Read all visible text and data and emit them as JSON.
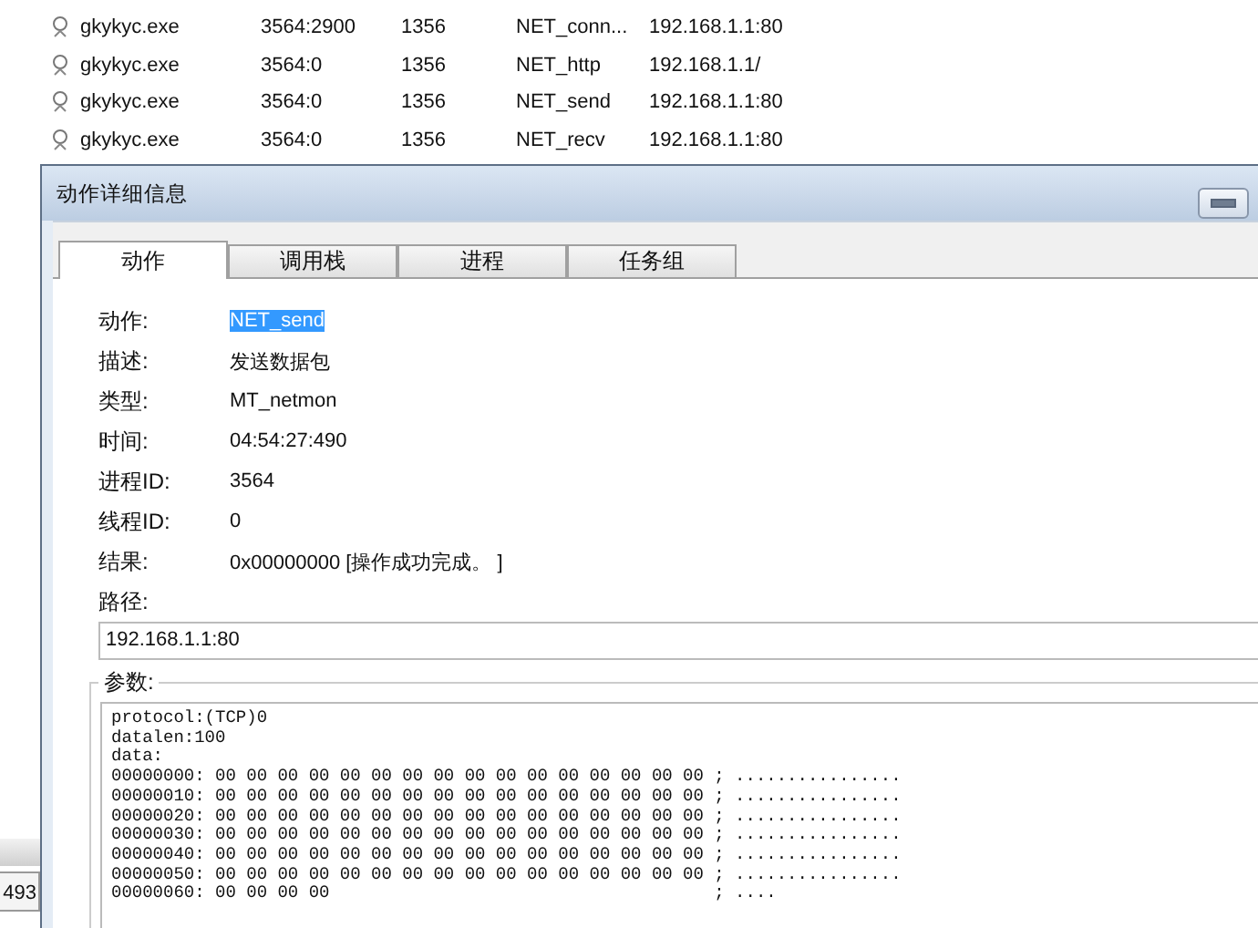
{
  "process_list": {
    "rows": [
      {
        "name": "gkykyc.exe",
        "pid_tid": "3564:2900",
        "column_4": "1356",
        "action": "NET_conn...",
        "path": "192.168.1.1:80"
      },
      {
        "name": "gkykyc.exe",
        "pid_tid": "3564:0",
        "column_4": "1356",
        "action": "NET_http",
        "path": "192.168.1.1/"
      },
      {
        "name": "gkykyc.exe",
        "pid_tid": "3564:0",
        "column_4": "1356",
        "action": "NET_send",
        "path": "192.168.1.1:80"
      },
      {
        "name": "gkykyc.exe",
        "pid_tid": "3564:0",
        "column_4": "1356",
        "action": "NET_recv",
        "path": "192.168.1.1:80"
      }
    ],
    "status_cell": "493"
  },
  "dialog": {
    "title": "动作详细信息",
    "tabs": [
      {
        "label": "动作",
        "selected": true
      },
      {
        "label": "调用栈",
        "selected": false
      },
      {
        "label": "进程",
        "selected": false
      },
      {
        "label": "任务组",
        "selected": false
      }
    ],
    "fields": [
      {
        "label": "动作:",
        "value": "NET_send",
        "highlighted": true
      },
      {
        "label": "描述:",
        "value": "发送数据包",
        "highlighted": false
      },
      {
        "label": "类型:",
        "value": "MT_netmon",
        "highlighted": false
      },
      {
        "label": "时间:",
        "value": "04:54:27:490",
        "highlighted": false
      },
      {
        "label": "进程ID:",
        "value": "3564",
        "highlighted": false
      },
      {
        "label": "线程ID:",
        "value": "0",
        "highlighted": false
      },
      {
        "label": "结果:",
        "value": "0x00000000 [操作成功完成。 ]",
        "highlighted": false
      }
    ],
    "path_label": "路径:",
    "path_value": "192.168.1.1:80",
    "params_label": "参数:",
    "params_lines": [
      "protocol:(TCP)0",
      "datalen:100",
      "data:",
      "00000000: 00 00 00 00 00 00 00 00 00 00 00 00 00 00 00 00 ; ................",
      "00000010: 00 00 00 00 00 00 00 00 00 00 00 00 00 00 00 00 ; ................",
      "00000020: 00 00 00 00 00 00 00 00 00 00 00 00 00 00 00 00 ; ................",
      "00000030: 00 00 00 00 00 00 00 00 00 00 00 00 00 00 00 00 ; ................",
      "00000040: 00 00 00 00 00 00 00 00 00 00 00 00 00 00 00 00 ; ................",
      "00000050: 00 00 00 00 00 00 00 00 00 00 00 00 00 00 00 00 ; ................",
      "00000060: 00 00 00 00                                     ; ...."
    ]
  }
}
